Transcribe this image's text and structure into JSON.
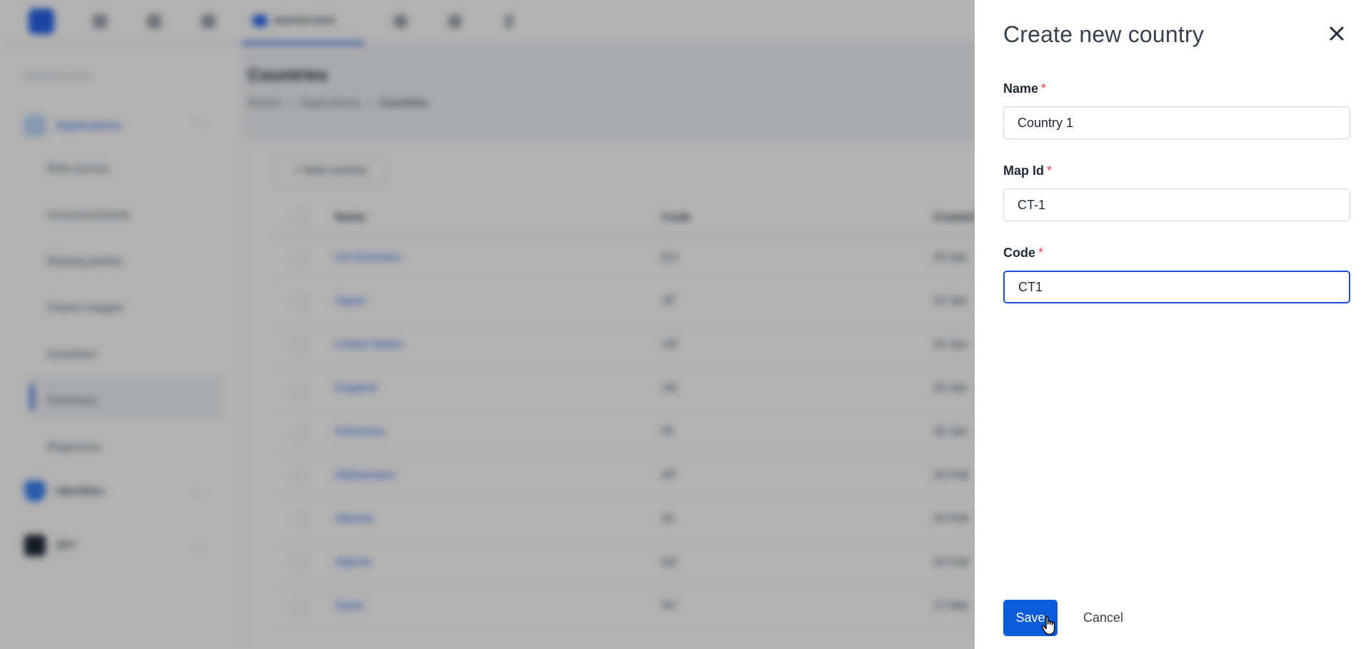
{
  "topnav": {
    "active_tab": "MASTER DATA",
    "icons": [
      "home-icon",
      "user-icon",
      "grid-icon",
      "globe-icon",
      "settings-icon",
      "info-icon"
    ]
  },
  "sidebar": {
    "section_label": "MASTER DATA",
    "groups": [
      {
        "label": "Applications",
        "icon": "apps-icon",
        "expanded": true
      },
      {
        "label": "Identities",
        "icon": "shield-icon",
        "expanded": false
      },
      {
        "label": "API",
        "icon": "terminal-icon",
        "expanded": false
      }
    ],
    "items": [
      "Role access",
      "Announcements",
      "Relying parties",
      "Claims mapper",
      "Countries",
      "Provinces",
      "Regencies"
    ],
    "active_item": "Countries"
  },
  "main": {
    "title": "Countries",
    "breadcrumbs": [
      "Master",
      "Applications",
      "Countries"
    ],
    "new_button_label": "+ New country",
    "columns": [
      "Name",
      "Code",
      "Created"
    ],
    "rows": [
      {
        "name": "Uni Emirates",
        "code": "EU",
        "date": "20 Jan"
      },
      {
        "name": "Japan",
        "code": "JP",
        "date": "22 Jan"
      },
      {
        "name": "United States",
        "code": "US",
        "date": "20 Jan"
      },
      {
        "name": "England",
        "code": "UK",
        "date": "20 Jan"
      },
      {
        "name": "Indonesia",
        "code": "RI",
        "date": "20 Jan"
      },
      {
        "name": "Afghanistan",
        "code": "AF",
        "date": "24 Feb"
      },
      {
        "name": "Albania",
        "code": "AL",
        "date": "24 Feb"
      },
      {
        "name": "Algeria",
        "code": "DZ",
        "date": "24 Feb"
      },
      {
        "name": "Spain",
        "code": "SY",
        "date": "17 Mar"
      }
    ]
  },
  "drawer": {
    "title": "Create new country",
    "required_mark": "*",
    "fields": {
      "name": {
        "label": "Name",
        "value": "Country 1"
      },
      "map_id": {
        "label": "Map Id",
        "value": "CT-1"
      },
      "code": {
        "label": "Code",
        "value": "CT1"
      }
    },
    "save_label": "Save",
    "cancel_label": "Cancel"
  },
  "colors": {
    "primary": "#0b5cd8",
    "focus_border": "#1d4ed8",
    "required": "#ef4444",
    "overlay": "rgba(0,0,0,0.30)"
  }
}
